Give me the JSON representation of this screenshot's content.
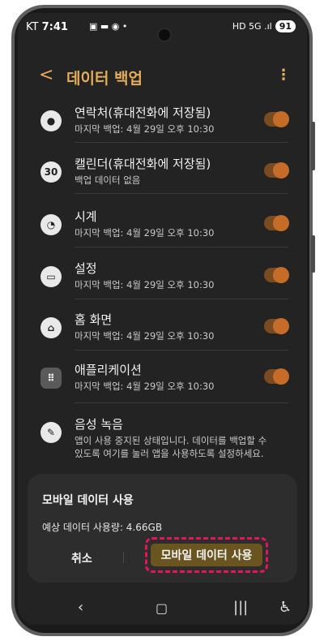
{
  "status": {
    "carrier": "KT",
    "time": "7:41",
    "battery": "91",
    "right_icons": "HD 5G .ıl"
  },
  "header": {
    "title": "데이터 백업",
    "back_icon": "back-icon",
    "more_icon": "more-vert-icon"
  },
  "items": [
    {
      "name": "연락처(휴대전화에 저장됨)",
      "sub": "마지막 백업: 4월 29일 오후 10:30",
      "icon": "contacts-icon",
      "toggle": true
    },
    {
      "name": "캘린더(휴대전화에 저장됨)",
      "sub": "백업 데이터 없음",
      "icon": "calendar-icon",
      "icon_text": "30",
      "toggle": true
    },
    {
      "name": "시계",
      "sub": "마지막 백업: 4월 29일 오후 10:30",
      "icon": "clock-icon",
      "toggle": true
    },
    {
      "name": "설정",
      "sub": "마지막 백업: 4월 29일 오후 10:30",
      "icon": "settings-icon",
      "toggle": true
    },
    {
      "name": "홈 화면",
      "sub": "마지막 백업: 4월 29일 오후 10:30",
      "icon": "home-icon",
      "toggle": true
    },
    {
      "name": "애플리케이션",
      "sub": "마지막 백업: 4월 29일 오후 10:30",
      "icon": "apps-icon",
      "toggle": true
    },
    {
      "name": "음성 녹음",
      "sub1": "앱이 사용 중지된 상태입니다. 데이터를 백업할 수",
      "sub2": "있도록 여기를 눌러 앱을 사용하도록 설정하세요.",
      "icon": "voice-recorder-icon"
    }
  ],
  "dialog": {
    "title": "모바일 데이터 사용",
    "usage": "예상 데이터 사용량: 4.66GB",
    "cancel": "취소",
    "confirm": "모바일 데이터 사용"
  },
  "colors": {
    "accent": "#e3ad5c",
    "toggle": "#c56d28",
    "highlight": "#e4155b"
  }
}
